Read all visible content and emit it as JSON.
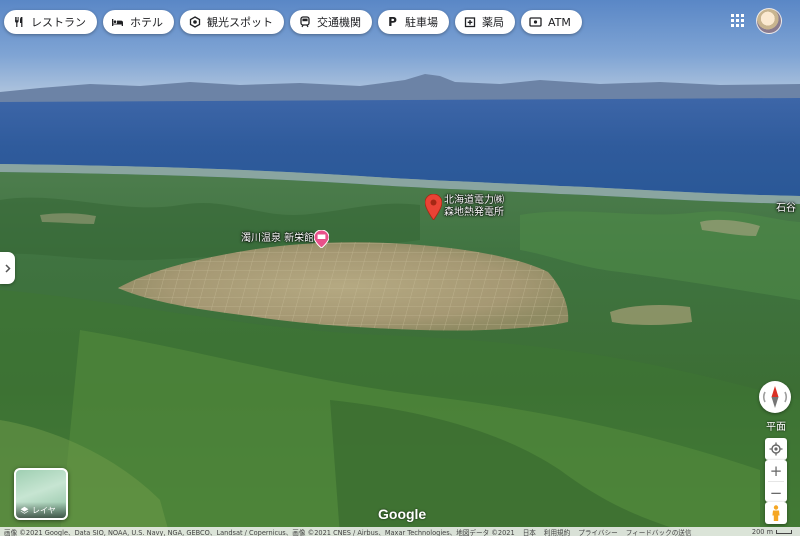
{
  "chips": [
    {
      "icon": "fork-knife-icon",
      "label": "レストラン"
    },
    {
      "icon": "bed-icon",
      "label": "ホテル"
    },
    {
      "icon": "camera-icon",
      "label": "観光スポット"
    },
    {
      "icon": "train-icon",
      "label": "交通機関"
    },
    {
      "icon": "parking-icon",
      "label": "駐車場"
    },
    {
      "icon": "pharmacy-icon",
      "label": "薬局"
    },
    {
      "icon": "atm-icon",
      "label": "ATM"
    }
  ],
  "places": {
    "power_station": {
      "line1": "北海道電力㈱",
      "line2": "森地熱発電所",
      "marker_color": "#ea4335"
    },
    "hot_spring": {
      "label": "濁川温泉 新栄館",
      "marker_color": "#e8508a"
    },
    "edge": {
      "label": "石谷"
    }
  },
  "controls": {
    "layers_label": "レイヤ",
    "tilt_label": "平面",
    "zoom_in": "+",
    "zoom_out": "−"
  },
  "logo": "Google",
  "attribution": {
    "imagery": "画像 ©2021 Google、Data SIO, NOAA, U.S. Navy, NGA, GEBCO、Landsat / Copernicus、画像 ©2021 CNES / Airbus、Maxar Technologies、地図データ ©2021",
    "links": [
      "日本",
      "利用規約",
      "プライバシー",
      "フィードバックの送信"
    ],
    "scale": "200 m"
  },
  "colors": {
    "sea": "#2d5fa3",
    "forest": "#3f6e3a",
    "farmland": "#a89d78",
    "chip_bg": "#ffffff"
  }
}
